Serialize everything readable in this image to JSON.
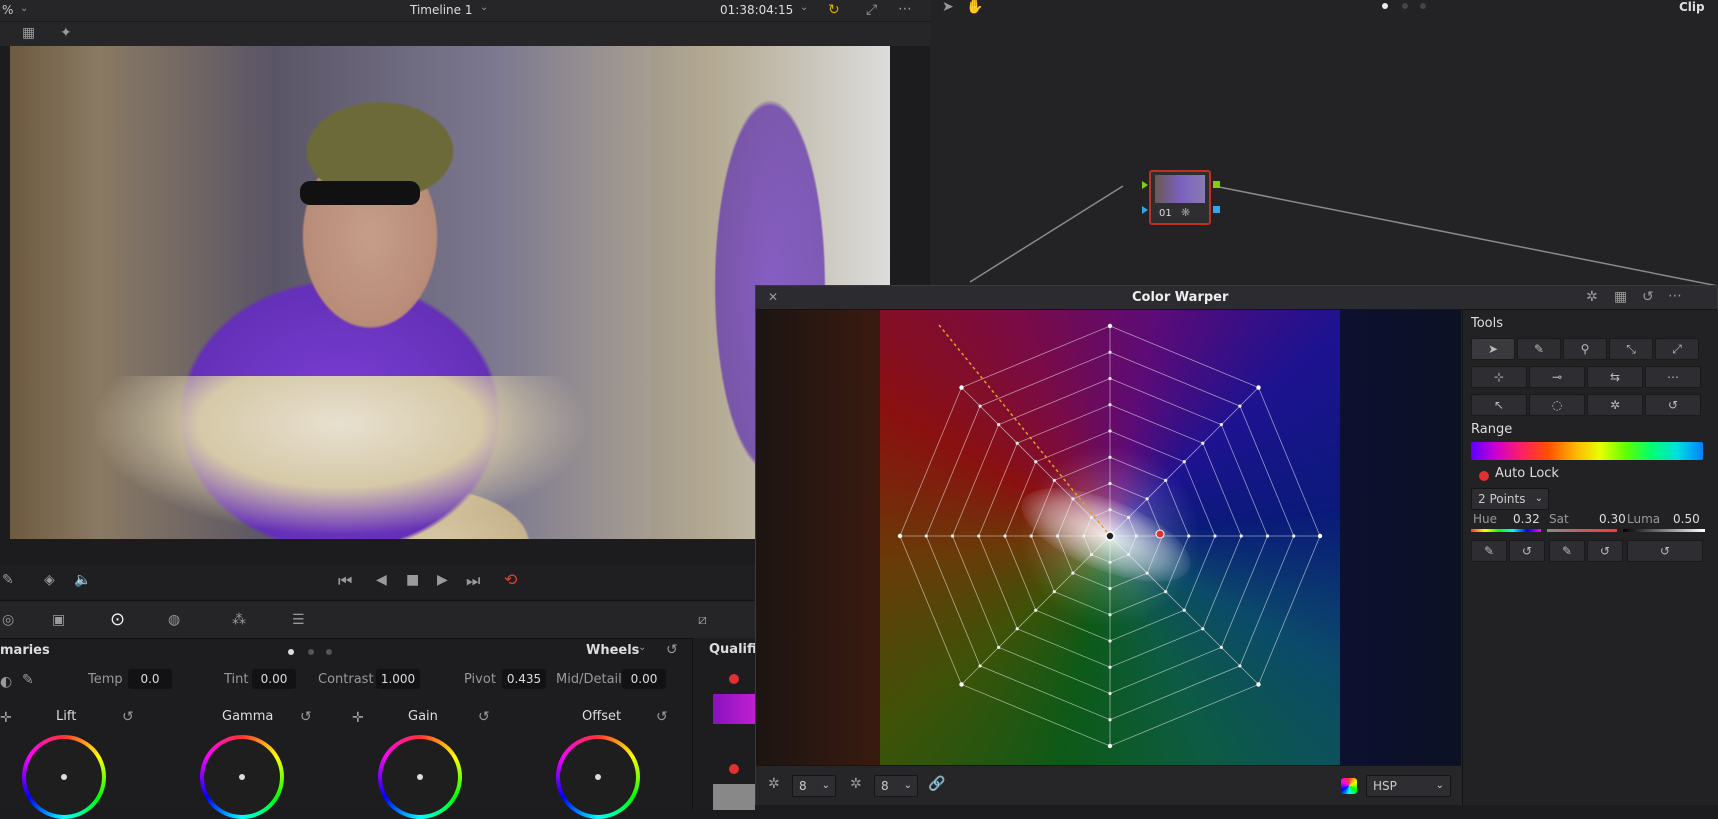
{
  "viewer": {
    "zoom_partial": "%",
    "timeline_title": "Timeline 1",
    "timecode": "01:38:04:15"
  },
  "node_editor": {
    "mode_label": "Clip",
    "node_number": "01"
  },
  "palette": {
    "section_left": "maries",
    "section_mode": "Wheels",
    "section_right": "Qualifi"
  },
  "primaries": {
    "temp_label": "Temp",
    "temp_value": "0.0",
    "tint_label": "Tint",
    "tint_value": "0.00",
    "contrast_label": "Contrast",
    "contrast_value": "1.000",
    "pivot_label": "Pivot",
    "pivot_value": "0.435",
    "middetail_label": "Mid/Detail",
    "middetail_value": "0.00",
    "wheels": [
      {
        "label": "Lift"
      },
      {
        "label": "Gamma"
      },
      {
        "label": "Gain"
      },
      {
        "label": "Offset"
      }
    ]
  },
  "color_warper": {
    "title": "Color Warper",
    "tools_label": "Tools",
    "range_label": "Range",
    "auto_lock_label": "Auto Lock",
    "points_option": "2 Points",
    "hue_label": "Hue",
    "hue_value": "0.32",
    "sat_label": "Sat",
    "sat_value": "0.30",
    "luma_label": "Luma",
    "luma_value": "0.50",
    "hue_res": "8",
    "sat_res": "8",
    "color_space": "HSP"
  },
  "icons": [
    "close-icon",
    "grid-icon",
    "reset-icon",
    "more-icon",
    "pointer-icon",
    "hand-icon",
    "link-icon",
    "chevron-down-icon"
  ]
}
